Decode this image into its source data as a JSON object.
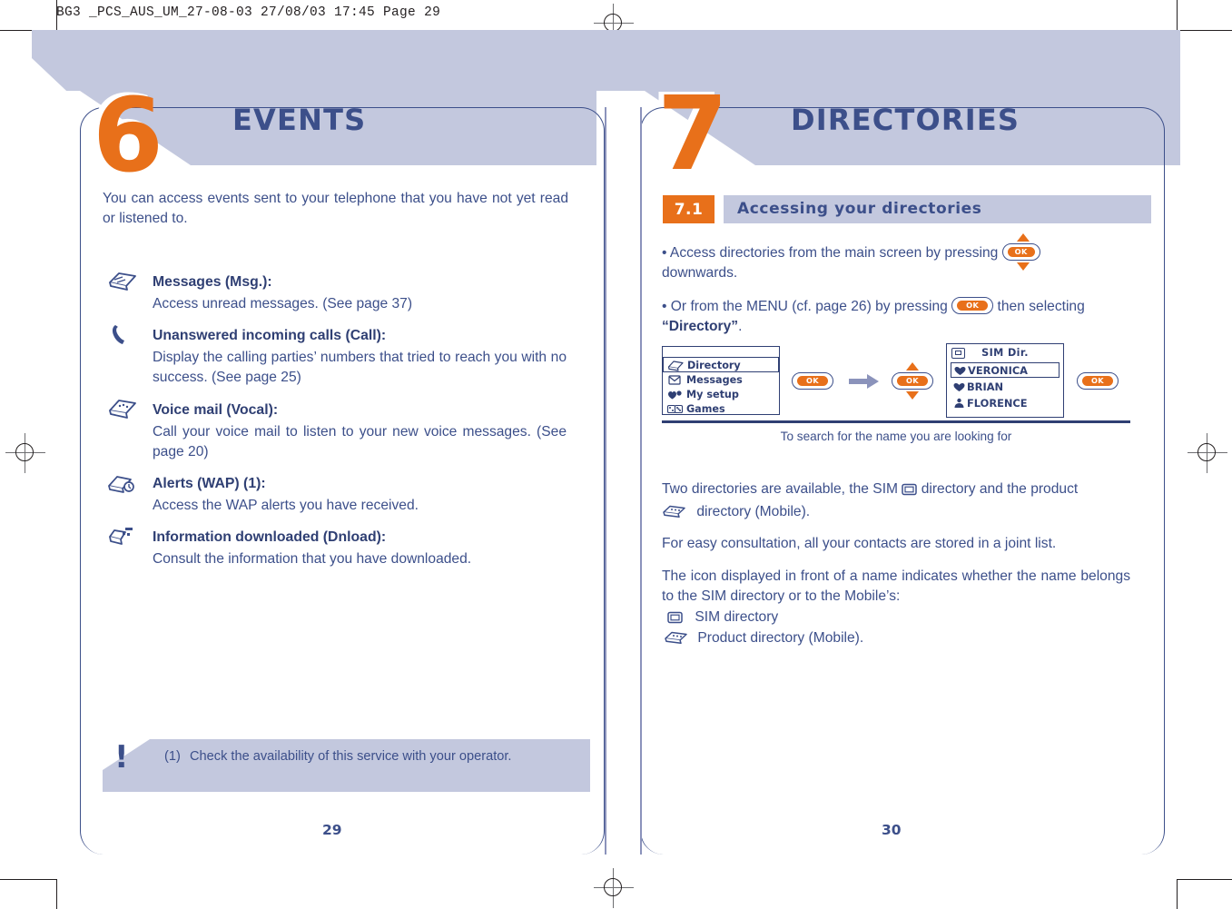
{
  "document": {
    "slug": "BG3 _PCS_AUS_UM_27-08-03  27/08/03  17:45  Page 29"
  },
  "colors": {
    "accent_orange": "#e8701a",
    "ink_blue": "#3c4f8a",
    "deep_blue": "#2f3f73",
    "band_lavender": "#c3c8de"
  },
  "left_page": {
    "chapter_number": "6",
    "chapter_title": "EVENTS",
    "intro": "You can access events sent to your telephone that you have not yet read or listened to.",
    "items": [
      {
        "icon": "messages-icon",
        "heading": "Messages (Msg.)",
        "heading_suffix": ":",
        "body": "Access unread messages. (See page 37)"
      },
      {
        "icon": "handset-icon",
        "heading": "Unanswered incoming calls (Call):",
        "heading_suffix": "",
        "body": "Display the calling parties’ numbers that tried to reach you with no success. (See page 25)"
      },
      {
        "icon": "voicemail-icon",
        "heading": "Voice mail (Vocal):",
        "heading_suffix": "",
        "body": "Call your voice mail to listen to your new voice messages. (See page 20)"
      },
      {
        "icon": "wap-alerts-icon",
        "heading": "Alerts (WAP) (1)",
        "heading_suffix": ":",
        "body": "Access the WAP alerts you have received."
      },
      {
        "icon": "download-icon",
        "heading": "Information downloaded (Dnload):",
        "heading_suffix": "",
        "body": "Consult the information that you have downloaded."
      }
    ],
    "footnote": {
      "marker": "(1)",
      "text": "Check the availability of this service with your operator."
    },
    "page_number": "29"
  },
  "right_page": {
    "chapter_number": "7",
    "chapter_title": "DIRECTORIES",
    "section": {
      "number": "7.1",
      "title": "Accessing your directories"
    },
    "bullets": [
      {
        "prefix": "• Access directories from the main screen by pressing",
        "button": "OK",
        "suffix": "downwards."
      },
      {
        "prefix": "• Or from the MENU (cf. page 26) by pressing",
        "button": "OK",
        "mid": "then selecting",
        "emphasis": "“Directory”",
        "suffix": "."
      }
    ],
    "diagram": {
      "menu_screen": {
        "rows": [
          {
            "icon": "directory-icon",
            "label": "Directory",
            "highlighted": true
          },
          {
            "icon": "messages-icon",
            "label": "Messages",
            "highlighted": false
          },
          {
            "icon": "mysetup-icon",
            "label": "My setup",
            "highlighted": false
          },
          {
            "icon": "games-icon",
            "label": "Games",
            "highlighted": false
          }
        ]
      },
      "ok_button_1": "OK",
      "arrow": "arrow-right-icon",
      "ok_button_2": "OK",
      "sim_screen": {
        "icon": "sim-card-icon",
        "title": "SIM Dir.",
        "rows": [
          {
            "icon": "heart-icon",
            "label": "VERONICA",
            "highlighted": true
          },
          {
            "icon": "heart-icon",
            "label": "BRIAN",
            "highlighted": false
          },
          {
            "icon": "person-icon",
            "label": "FLORENCE",
            "highlighted": false
          }
        ]
      },
      "ok_button_3": "OK",
      "caption": "To search for the name you are looking for"
    },
    "paragraphs": [
      {
        "part1": "Two directories are available, the SIM",
        "icon1": "sim-card-icon",
        "part2": "directory and the product",
        "icon2": "mobile-directory-icon",
        "part3": "directory (Mobile)."
      },
      {
        "text": "For easy consultation, all your contacts are stored in a joint list."
      },
      {
        "text": "The icon displayed in front of a name indicates whether the name belongs to the SIM directory or to the Mobile’s:"
      }
    ],
    "legend": [
      {
        "icon": "sim-card-icon",
        "label": "SIM directory"
      },
      {
        "icon": "mobile-directory-icon",
        "label": "Product directory (Mobile)."
      }
    ],
    "page_number": "30"
  }
}
